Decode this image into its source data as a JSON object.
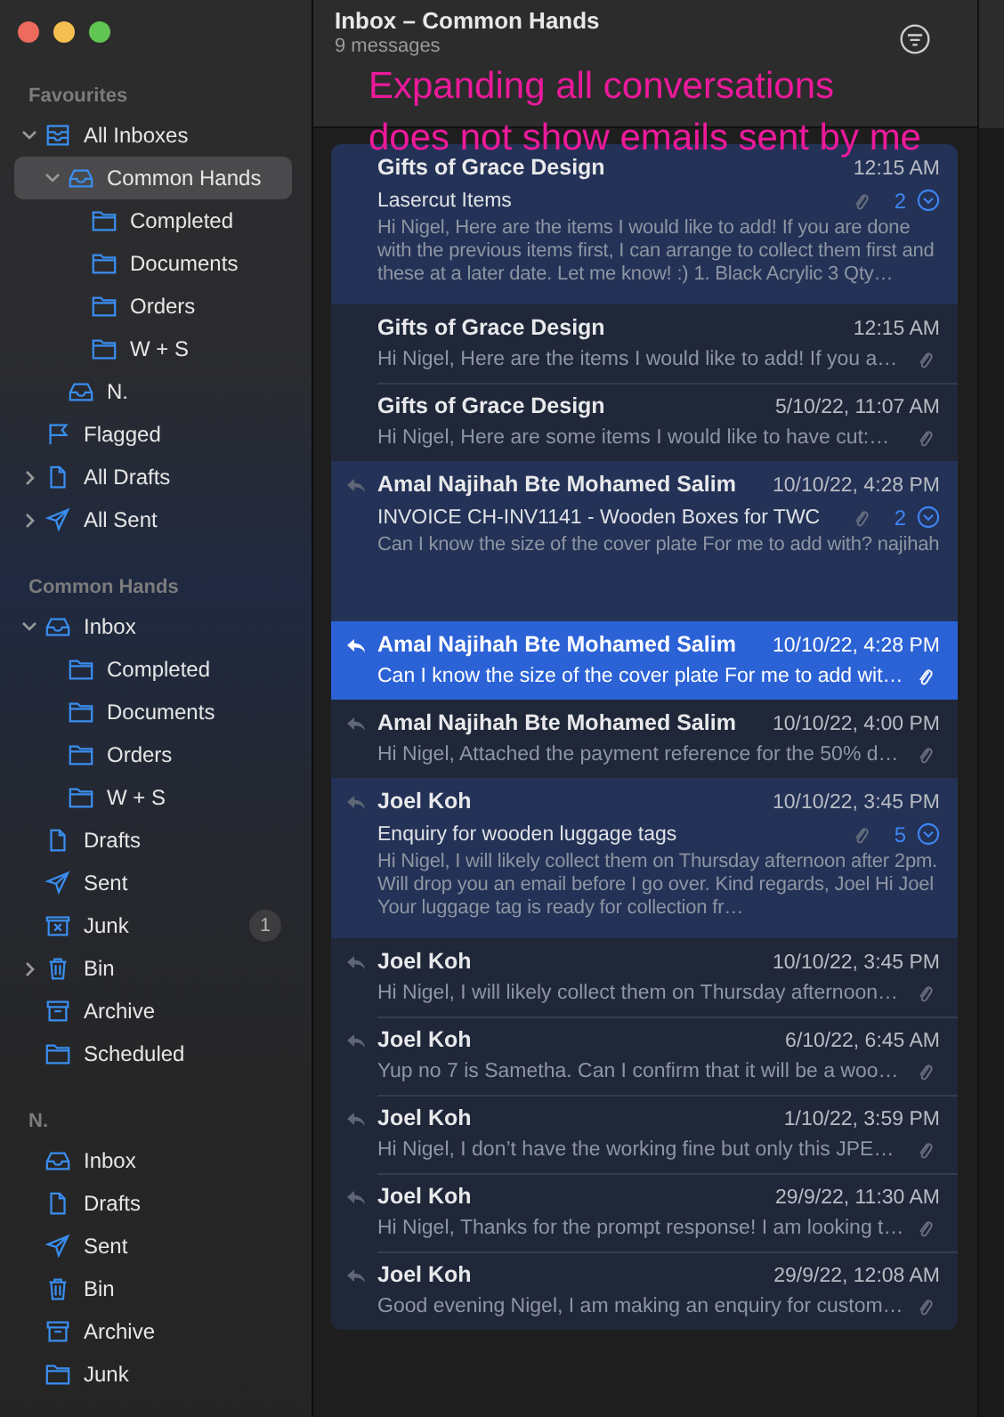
{
  "sidebar": {
    "sections": [
      {
        "title": "Favourites",
        "items": [
          {
            "label": "All Inboxes",
            "kind": "all-inboxes",
            "expanded": true,
            "selected": false,
            "children": [
              {
                "label": "Common Hands",
                "kind": "inbox",
                "expanded": true,
                "selected": true,
                "children": [
                  {
                    "label": "Completed",
                    "kind": "folder",
                    "selected": false
                  },
                  {
                    "label": "Documents",
                    "kind": "folder",
                    "selected": false
                  },
                  {
                    "label": "Orders",
                    "kind": "folder",
                    "selected": false
                  },
                  {
                    "label": "W + S",
                    "kind": "folder",
                    "selected": false
                  }
                ]
              },
              {
                "label": "N.",
                "kind": "inbox",
                "selected": false
              }
            ]
          },
          {
            "label": "Flagged",
            "kind": "flag",
            "selected": false
          },
          {
            "label": "All Drafts",
            "kind": "draft",
            "expanded": false,
            "selected": false
          },
          {
            "label": "All Sent",
            "kind": "sent",
            "expanded": false,
            "selected": false
          }
        ]
      },
      {
        "title": "Common Hands",
        "items": [
          {
            "label": "Inbox",
            "kind": "inbox",
            "expanded": true,
            "selected": false,
            "children": [
              {
                "label": "Completed",
                "kind": "folder",
                "selected": false
              },
              {
                "label": "Documents",
                "kind": "folder",
                "selected": false
              },
              {
                "label": "Orders",
                "kind": "folder",
                "selected": false
              },
              {
                "label": "W + S",
                "kind": "folder",
                "selected": false
              }
            ]
          },
          {
            "label": "Drafts",
            "kind": "draft",
            "selected": false
          },
          {
            "label": "Sent",
            "kind": "sent",
            "selected": false
          },
          {
            "label": "Junk",
            "kind": "junk",
            "selected": false,
            "badge": "1"
          },
          {
            "label": "Bin",
            "kind": "bin",
            "expanded": false,
            "selected": false
          },
          {
            "label": "Archive",
            "kind": "archive",
            "selected": false
          },
          {
            "label": "Scheduled",
            "kind": "folder",
            "selected": false
          }
        ]
      },
      {
        "title": "N.",
        "items": [
          {
            "label": "Inbox",
            "kind": "inbox",
            "selected": false
          },
          {
            "label": "Drafts",
            "kind": "draft",
            "selected": false
          },
          {
            "label": "Sent",
            "kind": "sent",
            "selected": false
          },
          {
            "label": "Bin",
            "kind": "bin",
            "selected": false
          },
          {
            "label": "Archive",
            "kind": "archive",
            "selected": false
          },
          {
            "label": "Junk",
            "kind": "folder",
            "selected": false
          }
        ]
      }
    ]
  },
  "header": {
    "title": "Inbox – Common Hands",
    "subtitle": "9 messages"
  },
  "annotation": [
    "Expanding all conversations",
    "does not show emails sent by me"
  ],
  "messages": [
    {
      "kind": "thread",
      "sender": "Gifts of Grace Design",
      "date": "12:15 AM",
      "subject": "Lasercut Items",
      "count": "2",
      "preview": "Hi Nigel, Here are the items I would like to add! If you are done with the previous items first, I can arrange to collect them first and these at a later date. Let me know! :) 1. Black Acrylic 3 Qty…",
      "replied": false,
      "attachment": true,
      "selected": false
    },
    {
      "kind": "message",
      "sender": "Gifts of Grace Design",
      "date": "12:15 AM",
      "preview": "Hi Nigel, Here are the items I would like to add! If you a…",
      "replied": false,
      "attachment": true,
      "selected": false
    },
    {
      "kind": "message",
      "sender": "Gifts of Grace Design",
      "date": "5/10/22, 11:07 AM",
      "preview": "Hi Nigel, Here are some items I would like to have cut:…",
      "replied": false,
      "attachment": true,
      "selected": false
    },
    {
      "kind": "thread",
      "sender": "Amal Najihah Bte Mohamed Salim",
      "date": "10/10/22, 4:28 PM",
      "subject": "INVOICE CH-INV1141 - Wooden Boxes for TWC",
      "count": "2",
      "preview": "Can I know the size of the cover plate For me to add with? najihah",
      "replied": true,
      "attachment": true,
      "selected": false
    },
    {
      "kind": "message",
      "sender": "Amal Najihah Bte Mohamed Salim",
      "date": "10/10/22, 4:28 PM",
      "preview": "Can I know the size of the cover plate For me to add wit…",
      "replied": true,
      "attachment": true,
      "selected": true
    },
    {
      "kind": "message",
      "sender": "Amal Najihah Bte Mohamed Salim",
      "date": "10/10/22, 4:00 PM",
      "preview": "Hi Nigel, Attached the payment reference for the 50% d…",
      "replied": true,
      "attachment": true,
      "selected": false
    },
    {
      "kind": "thread",
      "sender": "Joel Koh",
      "date": "10/10/22, 3:45 PM",
      "subject": "Enquiry for wooden luggage tags",
      "count": "5",
      "preview": "Hi Nigel, I will likely collect them on Thursday afternoon after 2pm. Will drop you an email before I go over. Kind regards, Joel Hi Joel Your luggage tag is ready for collection fr…",
      "replied": true,
      "attachment": true,
      "selected": false
    },
    {
      "kind": "message",
      "sender": "Joel Koh",
      "date": "10/10/22, 3:45 PM",
      "preview": "Hi Nigel, I will likely collect them on Thursday afternoon…",
      "replied": true,
      "attachment": true,
      "selected": false
    },
    {
      "kind": "message",
      "sender": "Joel Koh",
      "date": "6/10/22, 6:45 AM",
      "preview": "Yup no 7 is Sametha. Can I confirm that it will be a woo…",
      "replied": true,
      "attachment": true,
      "selected": false
    },
    {
      "kind": "message",
      "sender": "Joel Koh",
      "date": "1/10/22, 3:59 PM",
      "preview": "Hi Nigel, I don’t have the working fine but only this JPE…",
      "replied": true,
      "attachment": true,
      "selected": false
    },
    {
      "kind": "message",
      "sender": "Joel Koh",
      "date": "29/9/22, 11:30 AM",
      "preview": "Hi Nigel, Thanks for the prompt response! I am looking t…",
      "replied": true,
      "attachment": true,
      "selected": false
    },
    {
      "kind": "message",
      "sender": "Joel Koh",
      "date": "29/9/22, 12:08 AM",
      "preview": "Good evening Nigel, I am making an enquiry for custom…",
      "replied": true,
      "attachment": true,
      "selected": false
    }
  ]
}
